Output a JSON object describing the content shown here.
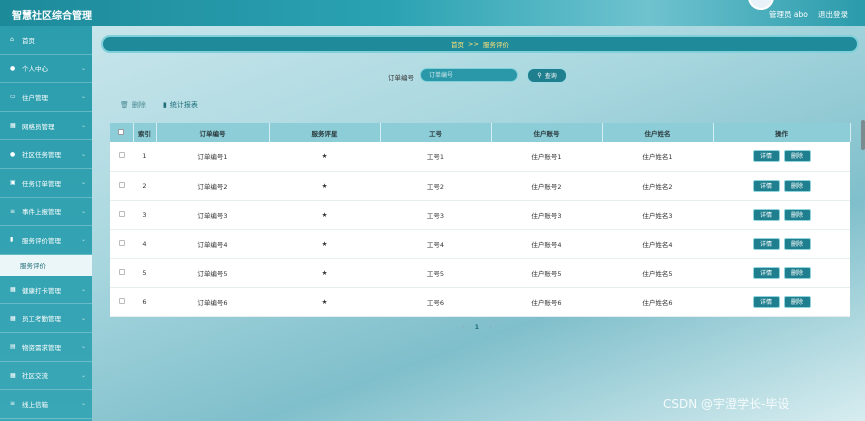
{
  "app": {
    "title": "智慧社区综合管理",
    "user": "管理员 abo",
    "logout": "退出登录"
  },
  "sidebar": {
    "items": [
      {
        "label": "首页",
        "icon": "home-icon",
        "glyph": "⌂"
      },
      {
        "label": "个人中心",
        "icon": "user-icon",
        "glyph": "●"
      },
      {
        "label": "住户管理",
        "icon": "card-icon",
        "glyph": "▭"
      },
      {
        "label": "网格员管理",
        "icon": "grid-icon",
        "glyph": "▦"
      },
      {
        "label": "社区任务管理",
        "icon": "user-icon",
        "glyph": "●"
      },
      {
        "label": "任务订单管理",
        "icon": "calendar-icon",
        "glyph": "▣"
      },
      {
        "label": "事件上报管理",
        "icon": "sliders-icon",
        "glyph": "≡"
      },
      {
        "label": "服务评价管理",
        "icon": "bar-chart-icon",
        "glyph": "▮"
      }
    ],
    "active_sub": "服务评价",
    "items_after": [
      {
        "label": "健康打卡管理",
        "icon": "grid-icon",
        "glyph": "▦"
      },
      {
        "label": "员工考勤管理",
        "icon": "grid-icon",
        "glyph": "▦"
      },
      {
        "label": "物资需求管理",
        "icon": "print-icon",
        "glyph": "▤"
      },
      {
        "label": "社区交流",
        "icon": "grid-icon",
        "glyph": "▦"
      },
      {
        "label": "线上信箱",
        "icon": "list-icon",
        "glyph": "≡"
      }
    ]
  },
  "breadcrumb": {
    "home": "首页",
    "sep": ">>",
    "current": "服务评价"
  },
  "search": {
    "label": "订单编号",
    "placeholder": "订单编号",
    "button": "查询"
  },
  "actions": {
    "delete": "删除",
    "stats": "统计报表"
  },
  "table": {
    "columns": [
      "索引",
      "订单编号",
      "服务评星",
      "工号",
      "住户账号",
      "住户姓名",
      "操作"
    ],
    "rows": [
      {
        "index": "1",
        "order": "订单编号1",
        "stars": "★",
        "emp": "工号1",
        "account": "住户账号1",
        "name": "住户姓名1"
      },
      {
        "index": "2",
        "order": "订单编号2",
        "stars": "★",
        "emp": "工号2",
        "account": "住户账号2",
        "name": "住户姓名2"
      },
      {
        "index": "3",
        "order": "订单编号3",
        "stars": "★",
        "emp": "工号3",
        "account": "住户账号3",
        "name": "住户姓名3"
      },
      {
        "index": "4",
        "order": "订单编号4",
        "stars": "★",
        "emp": "工号4",
        "account": "住户账号4",
        "name": "住户姓名4"
      },
      {
        "index": "5",
        "order": "订单编号5",
        "stars": "★",
        "emp": "工号5",
        "account": "住户账号5",
        "name": "住户姓名5"
      },
      {
        "index": "6",
        "order": "订单编号6",
        "stars": "★",
        "emp": "工号6",
        "account": "住户账号6",
        "name": "住户姓名6"
      }
    ],
    "detail_btn": "详情",
    "delete_btn": "删除"
  },
  "pagination": {
    "prev": "‹",
    "current": "1",
    "next": "›"
  },
  "watermark": "CSDN @宇澄学长-毕设"
}
